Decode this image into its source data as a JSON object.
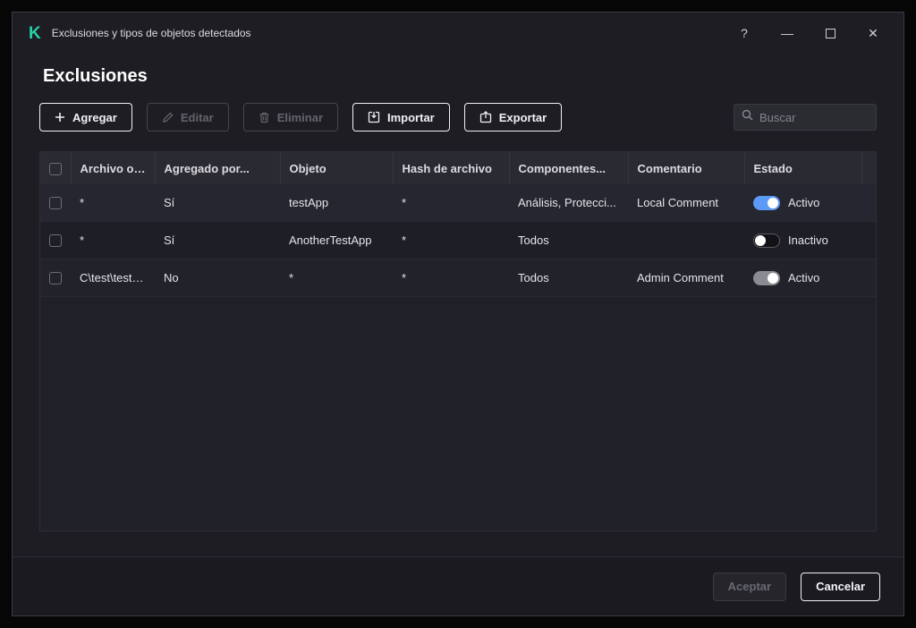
{
  "window": {
    "title": "Exclusiones y tipos de objetos detectados",
    "controls": {
      "help": "?",
      "minimize": "—",
      "close": "✕"
    }
  },
  "page": {
    "title": "Exclusiones"
  },
  "toolbar": {
    "add_label": "Agregar",
    "edit_label": "Editar",
    "delete_label": "Eliminar",
    "import_label": "Importar",
    "export_label": "Exportar",
    "search_placeholder": "Buscar"
  },
  "table": {
    "columns": [
      "Archivo o c...",
      "Agregado por...",
      "Objeto",
      "Hash de archivo",
      "Componentes...",
      "Comentario",
      "Estado"
    ],
    "rows": [
      {
        "file": "*",
        "added_by": "Sí",
        "object": "testApp",
        "hash": "*",
        "components": "Análisis, Protecci...",
        "comment": "Local Comment",
        "state": "Activo",
        "toggle_class": "toggle toggle-on"
      },
      {
        "file": "*",
        "added_by": "Sí",
        "object": "AnotherTestApp",
        "hash": "*",
        "components": "Todos",
        "comment": "",
        "state": "Inactivo",
        "toggle_class": "toggle toggle-off"
      },
      {
        "file": "C\\test\\test.e...",
        "added_by": "No",
        "object": "*",
        "hash": "*",
        "components": "Todos",
        "comment": "Admin Comment",
        "state": "Activo",
        "toggle_class": "toggle toggle-gray"
      }
    ]
  },
  "footer": {
    "ok_label": "Aceptar",
    "cancel_label": "Cancelar"
  },
  "colors": {
    "brand_green": "#27d0a8",
    "toggle_on_blue": "#5b9af5",
    "toggle_disabled_gray": "#8b8b92",
    "window_bg": "#1d1d23"
  }
}
